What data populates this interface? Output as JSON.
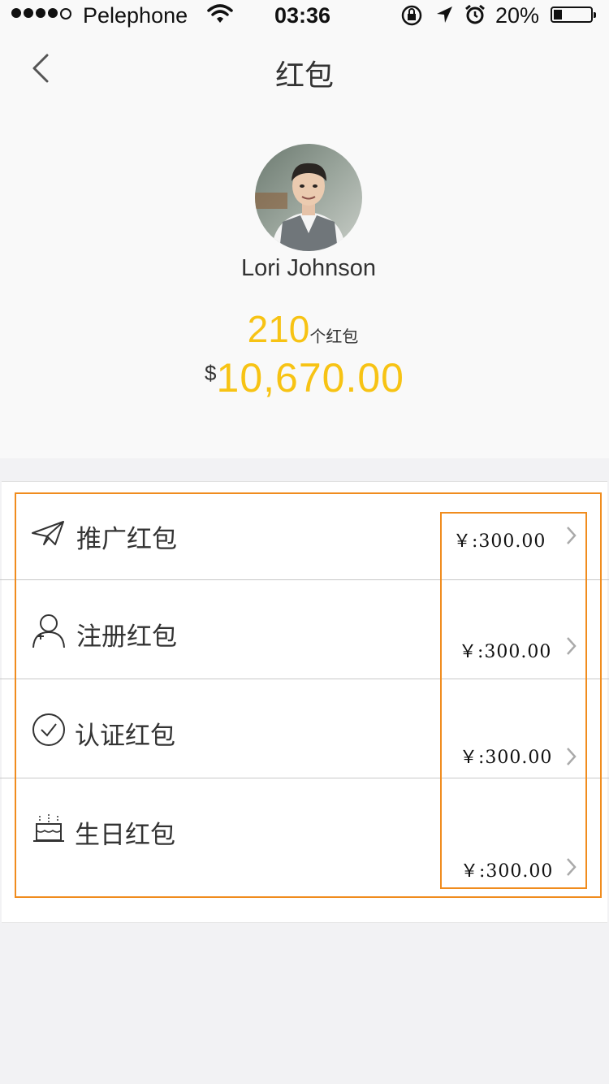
{
  "status_bar": {
    "carrier": "Pelephone",
    "time": "03:36",
    "battery_percent": "20%",
    "battery_level": 0.2
  },
  "nav": {
    "title": "红包",
    "back_icon": "chevron-left-icon"
  },
  "profile": {
    "name": "Lori Johnson",
    "count": "210",
    "count_unit": "个红包",
    "currency_symbol": "$",
    "total_amount": "10,670.00"
  },
  "list": [
    {
      "icon": "paper-plane-icon",
      "label": "推广红包",
      "value": "￥:300.00"
    },
    {
      "icon": "user-add-icon",
      "label": "注册红包",
      "value": "￥:300.00"
    },
    {
      "icon": "check-circle-icon",
      "label": "认证红包",
      "value": "￥:300.00"
    },
    {
      "icon": "birthday-cake-icon",
      "label": "生日红包",
      "value": "￥:300.00"
    }
  ],
  "colors": {
    "accent": "#f7c314",
    "annotation": "#f08c1e",
    "text": "#333333"
  }
}
